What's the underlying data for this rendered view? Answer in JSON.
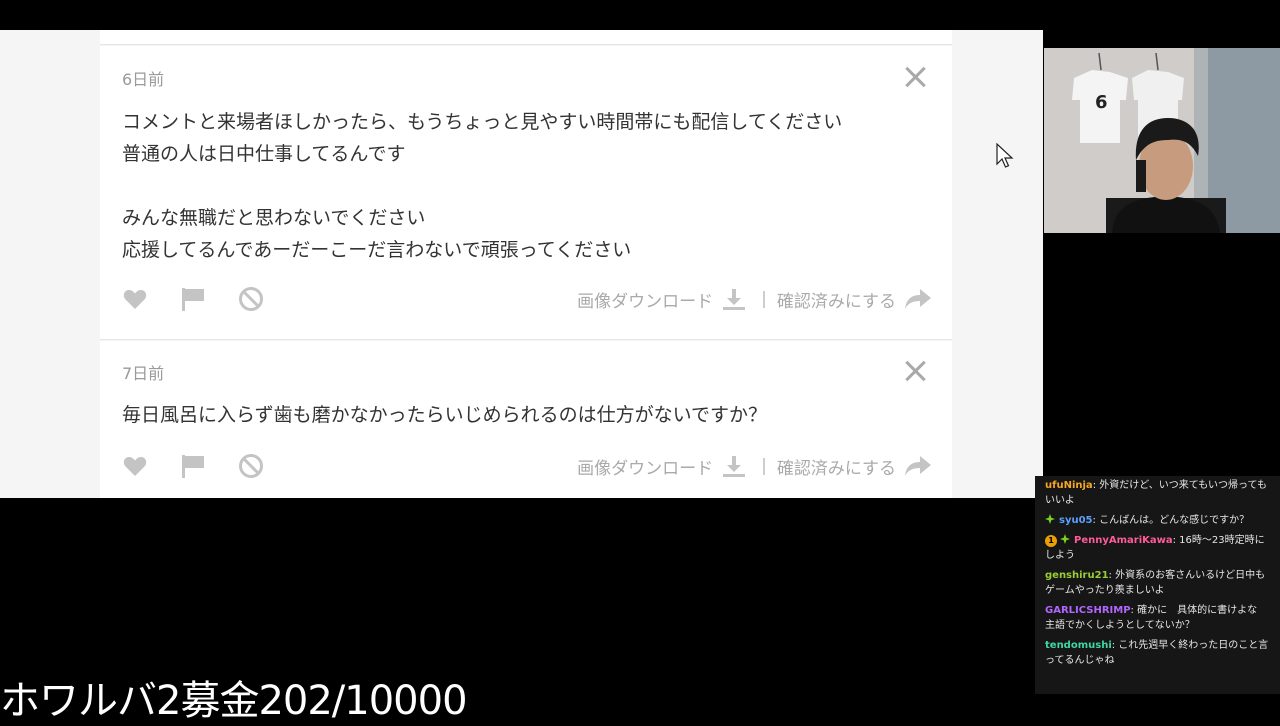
{
  "questions": [
    {
      "age": "6日前",
      "lines": [
        "コメントと来場者ほしかったら、もうちょっと見やすい時間帯にも配信してください",
        "普通の人は日中仕事してるんです",
        "",
        "みんな無職だと思わないでください",
        "応援してるんであーだーこーだ言わないで頑張ってください"
      ]
    },
    {
      "age": "7日前",
      "lines": [
        "毎日風呂に入らず歯も磨かなかったらいじめられるのは仕方がないですか？"
      ]
    }
  ],
  "actions": {
    "download": "画像ダウンロード",
    "separator": "|",
    "mark_checked": "確認済みにする"
  },
  "chat": [
    {
      "user": "ufuNinja",
      "user_color": "#f5a623",
      "text": ": 外資だけど、いつ来てもいつ帰ってもいいよ",
      "badges": []
    },
    {
      "user": "syu05",
      "user_color": "#5aa0ff",
      "text": ": こんばんは。どんな感じですか？",
      "badges": [
        "gem"
      ]
    },
    {
      "user": "PennyAmariKawa",
      "user_color": "#ff5a9c",
      "text": ": 16時〜23時定時にしよう",
      "badges": [
        "sub",
        "gem"
      ]
    },
    {
      "user": "genshiru21",
      "user_color": "#9acd32",
      "text": ": 外資系のお客さんいるけど日中もゲームやったり羨ましいよ",
      "badges": []
    },
    {
      "user": "GARLICSHRIMP",
      "user_color": "#b266ff",
      "text": ": 確かに　具体的に書けよな　主語でかくしようとしてないか？",
      "badges": []
    },
    {
      "user": "tendomushi",
      "user_color": "#3fd6a6",
      "text": ": これ先週早く終わった日のこと言ってるんじゃね",
      "badges": []
    }
  ],
  "sub_badge_text": "1",
  "donation_overlay": "ホワルバ2募金202/10000",
  "jersey_number": "6"
}
